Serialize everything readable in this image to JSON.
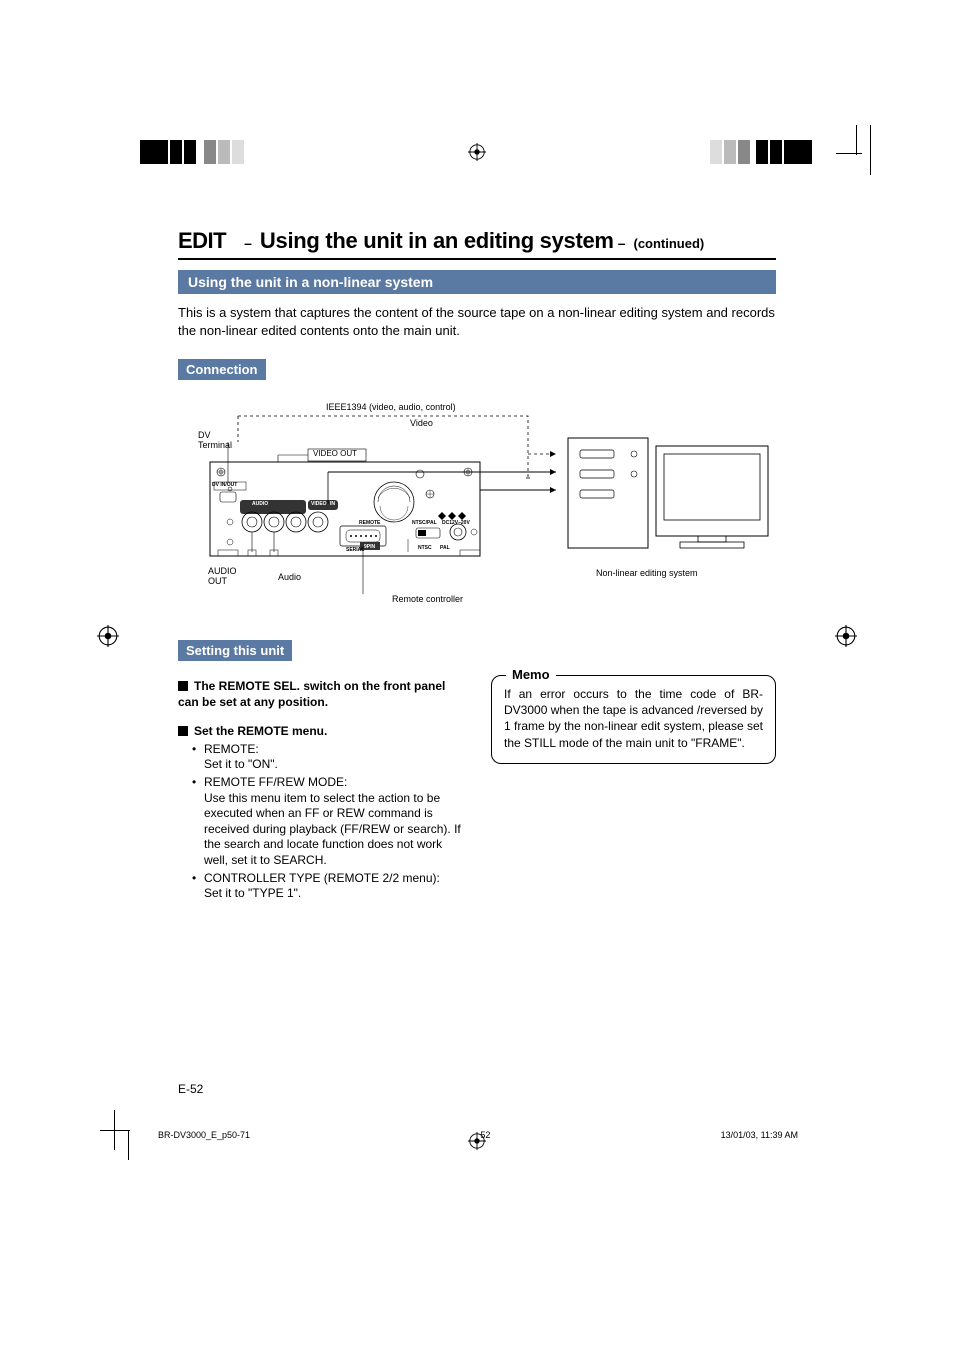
{
  "title": {
    "edit": "EDIT",
    "dash1": "–",
    "sub": "Using the unit in an editing system",
    "dash2": "–",
    "cont": "(continued)"
  },
  "section1_header": "Using the unit in a non-linear system",
  "section1_body": "This is a system that captures the content of the source tape on a non-linear editing system and records the non-linear edited contents onto the main unit.",
  "connection_header": "Connection",
  "diagram": {
    "ieee": "IEEE1394 (video, audio, control)",
    "video": "Video",
    "dv_terminal": "DV Terminal",
    "video_out": "VIDEO OUT",
    "dv_inout": "DV IN/OUT",
    "audio_sm": "AUDIO",
    "video_sm": "VIDEO",
    "in_sm": "IN",
    "remote_sm": "REMOTE",
    "ntscpal": "NTSC/PAL",
    "dc12v": "DC12V–20V",
    "serial": "SERIAL",
    "ntsc": "NTSC",
    "pal": "PAL",
    "_9pin": "9PIN",
    "audio_out": "AUDIO OUT",
    "audio": "Audio",
    "remote_controller": "Remote controller",
    "nonlinear": "Non-linear editing system"
  },
  "setting_header": "Setting this unit",
  "left_col": {
    "remote_sel": "The REMOTE SEL. switch on the front panel can be set at any position.",
    "set_remote_menu": "Set the REMOTE menu.",
    "b1_t": "REMOTE:",
    "b1_d": "Set it to \"ON\".",
    "b2_t": "REMOTE FF/REW MODE:",
    "b2_d": "Use this menu item to select the action to be executed when an FF or REW command is received during playback (FF/REW or search). If the search and locate function does not work well, set it to SEARCH.",
    "b3_t": "CONTROLLER TYPE (REMOTE 2/2 menu):",
    "b3_d": "Set it to \"TYPE 1\"."
  },
  "memo": {
    "title": "Memo",
    "text": "If an error occurs to the time code of BR-DV3000 when the tape is advanced /reversed by 1 frame by the non-linear edit system, please set the STILL mode of the main unit to \"FRAME\"."
  },
  "page_number": "E-52",
  "footer": {
    "file": "BR-DV3000_E_p50-71",
    "pg": "52",
    "date": "13/01/03, 11:39 AM"
  }
}
